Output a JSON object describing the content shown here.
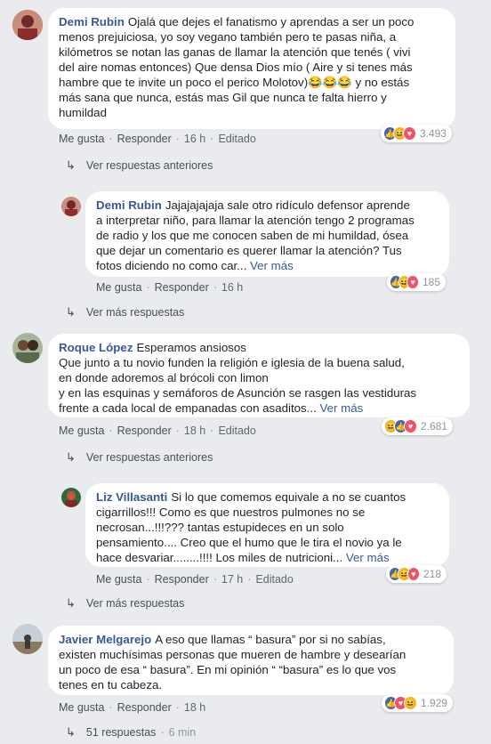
{
  "colors": {
    "background": "#e9ebee",
    "link": "#385898",
    "like": "#4267b2",
    "haha": "#f7b125",
    "love": "#f25268"
  },
  "action_labels": {
    "like": "Me gusta",
    "reply": "Responder",
    "edited": "Editado",
    "more": "Ver más"
  },
  "comments": [
    {
      "author": "Demi Rubin",
      "text_lines": [
        "Ojalá que dejes el fanatismo y aprendas a ser un poco",
        "menos prejuiciosa, yo soy vegano también pero te pasas niña, a",
        "kilómetros se notan las ganas de llamar la atención que tenés ( vivi",
        "del aire nomas entonces) Que densa Dios mío ( Aire y si tenes más",
        "hambre que te invite un poco el perico Molotov)😂😂😂 y no estás",
        "más sana que nunca, estás mas Gil que nunca te falta hierro y",
        "humildad"
      ],
      "time": "16 h",
      "reaction_count": "3.493",
      "replies_link": "Ver respuestas anteriores"
    },
    {
      "author": "Demi Rubin",
      "text_lines": [
        "Jajajajajaja sale otro ridículo defensor aprende",
        "a interpretar niño, para llamar la atención tengo 2 programas",
        "de radio y los que me conocen saben de mi humildad, ósea",
        "que dejar un comentario es querer llamar la atención? Tus",
        "fotos diciendo no como car..."
      ],
      "time": "16 h",
      "reaction_count": "185",
      "replies_link": "Ver más respuestas"
    },
    {
      "author": "Roque López",
      "text_lines": [
        "Esperamos ansiosos",
        "Que junto a tu novio funden la religión e iglesia de la buena salud,",
        "en donde adoremos al brócoli con limon",
        "y en las esquinas y semáforos de Asunción se rasgen las vestiduras",
        "frente a cada local de empanadas con asaditos..."
      ],
      "time": "18 h",
      "reaction_count": "2.681",
      "replies_link": "Ver respuestas anteriores"
    },
    {
      "author": "Liz Villasanti",
      "text_lines": [
        "Si lo que comemos equivale a no se cuantos",
        "cigarrillos!!! Como es que nuestros pulmones no se",
        "necrosan...!!!??? tantas estupideces en un solo",
        "pensamiento.... Creo que el humo que le tira el novio ya le",
        "hace desvariar........!!!! Los miles de nutricioni..."
      ],
      "time": "17 h",
      "reaction_count": "218",
      "replies_link": "Ver más respuestas"
    },
    {
      "author": "Javier Melgarejo",
      "text_lines": [
        "A eso que llamas “ basura” por si no sabías,",
        "existen muchísimas personas que mueren de hambre y desearían",
        "un poco de esa “ basura”. En mi opinión “ “basura” es lo que vos",
        "tenes en tu cabeza."
      ],
      "time": "18 h",
      "reaction_count": "1.929",
      "replies_link": "51 respuestas",
      "replies_time": "6 min"
    }
  ]
}
